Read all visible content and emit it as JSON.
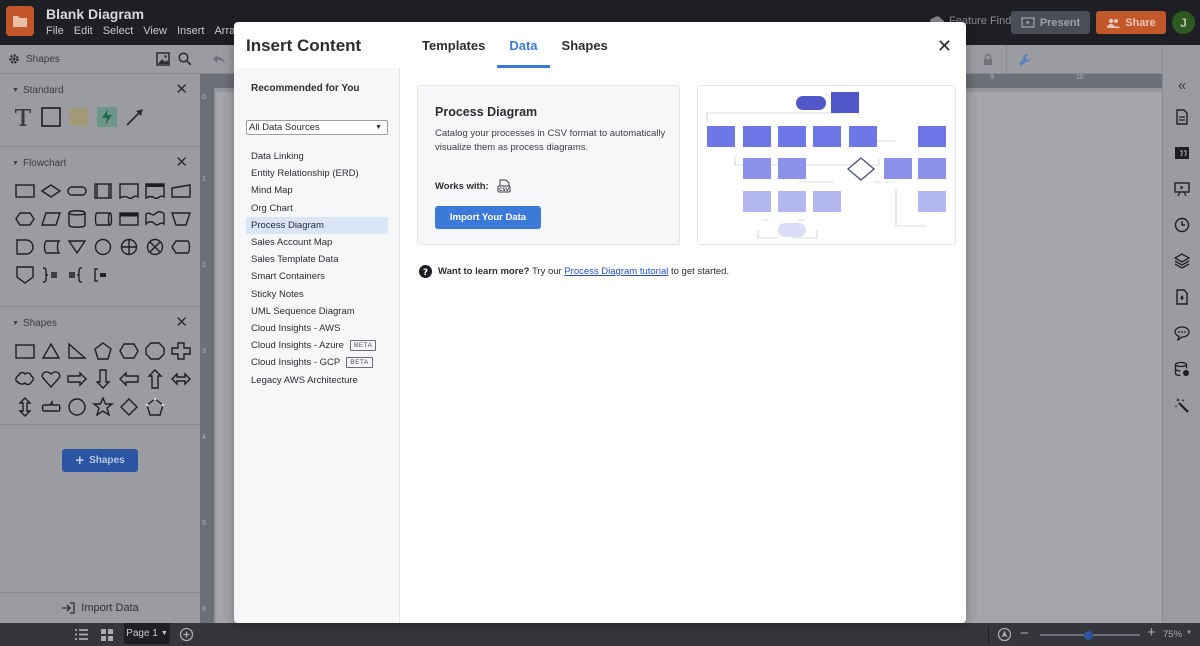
{
  "app": {
    "document_title": "Blank Diagram",
    "menu": [
      "File",
      "Edit",
      "Select",
      "View",
      "Insert",
      "Arrange"
    ],
    "feature_find": "Feature Find",
    "present_label": "Present",
    "share_label": "Share",
    "avatar_initial": "J"
  },
  "left_panel": {
    "title": "Shapes",
    "sections": [
      {
        "name": "Standard"
      },
      {
        "name": "Flowchart"
      },
      {
        "name": "Shapes"
      }
    ],
    "add_shapes_label": "Shapes",
    "import_data_label": "Import Data"
  },
  "rulers": {
    "top": [
      "9",
      "10"
    ],
    "left": [
      "0",
      "1",
      "2",
      "3",
      "4",
      "5",
      "6"
    ]
  },
  "bottom_bar": {
    "page_label": "Page 1",
    "zoom": "75%",
    "zoom_level_fraction": 0.48
  },
  "modal": {
    "title": "Insert Content",
    "tabs": [
      {
        "label": "Templates",
        "active": false
      },
      {
        "label": "Data",
        "active": true
      },
      {
        "label": "Shapes",
        "active": false
      }
    ],
    "sidebar": {
      "heading": "Recommended for You",
      "filter_value": "All Data Sources",
      "items": [
        {
          "label": "Data Linking"
        },
        {
          "label": "Entity Relationship (ERD)"
        },
        {
          "label": "Mind Map"
        },
        {
          "label": "Org Chart"
        },
        {
          "label": "Process Diagram",
          "selected": true
        },
        {
          "label": "Sales Account Map"
        },
        {
          "label": "Sales Template Data"
        },
        {
          "label": "Smart Containers"
        },
        {
          "label": "Sticky Notes"
        },
        {
          "label": "UML Sequence Diagram"
        },
        {
          "label": "Cloud Insights - AWS"
        },
        {
          "label": "Cloud Insights - Azure",
          "badge": "BETA"
        },
        {
          "label": "Cloud Insights - GCP",
          "badge": "BETA"
        },
        {
          "label": "Legacy AWS Architecture"
        }
      ]
    },
    "card": {
      "title": "Process Diagram",
      "description": "Catalog your processes in CSV format to automatically visualize them as process diagrams.",
      "works_with_label": "Works with:",
      "works_with_icon": "csv-file-icon",
      "button_label": "Import Your Data"
    },
    "learn_more": {
      "bold": "Want to learn more?",
      "prefix": " Try our ",
      "link": "Process Diagram tutorial",
      "suffix": " to get started."
    }
  },
  "colors": {
    "accent": "#3c7ad9",
    "share": "#c2572a",
    "selected_item": "#d9e6f8",
    "preview_dark": "#4f57c9",
    "preview_mid": "#7f86e6",
    "preview_light": "#b3b7f0"
  }
}
